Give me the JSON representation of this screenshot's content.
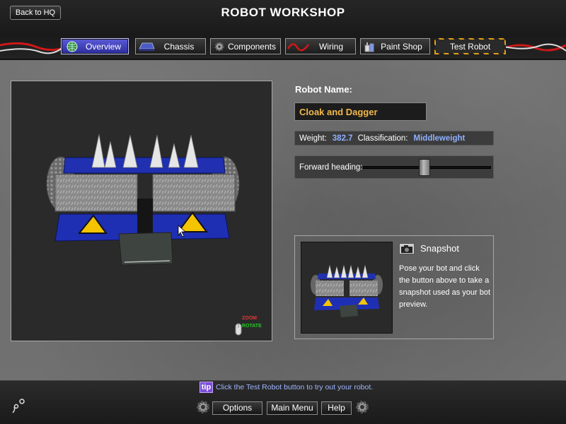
{
  "header": {
    "title": "ROBOT WORKSHOP",
    "back_label": "Back to HQ"
  },
  "tabs": [
    {
      "label": "Overview",
      "icon": "globe-icon",
      "active": true
    },
    {
      "label": "Chassis",
      "icon": "chassis-icon",
      "active": false
    },
    {
      "label": "Components",
      "icon": "gear-icon",
      "active": false
    },
    {
      "label": "Wiring",
      "icon": "wire-icon",
      "active": false
    },
    {
      "label": "Paint Shop",
      "icon": "paint-can-icon",
      "active": false
    },
    {
      "label": "Test Robot",
      "icon": "",
      "active": false
    }
  ],
  "viewport": {
    "zoom_label": "ZOOM",
    "rotate_label": "ROTATE"
  },
  "robot": {
    "name_label": "Robot Name:",
    "name_value": "Cloak and Dagger",
    "weight_label": "Weight:",
    "weight_value": "382.7",
    "class_label": "Classification:",
    "class_value": "Middleweight",
    "heading_label": "Forward heading:",
    "heading_level": 0.48
  },
  "snapshot": {
    "title": "Snapshot",
    "description": "Pose your bot and click the button above to take a snapshot used as your bot preview."
  },
  "footer": {
    "tip_badge": "tip",
    "tip_text": "Click the Test Robot button to try out your robot.",
    "options_label": "Options",
    "main_menu_label": "Main Menu",
    "help_label": "Help"
  },
  "colors": {
    "accent_orange": "#f2b84a",
    "value_blue": "#8fb0ff",
    "active_tab": "#3d3dbe",
    "robot_blue": "#1f2fb4",
    "warning_yellow": "#e3a018"
  }
}
